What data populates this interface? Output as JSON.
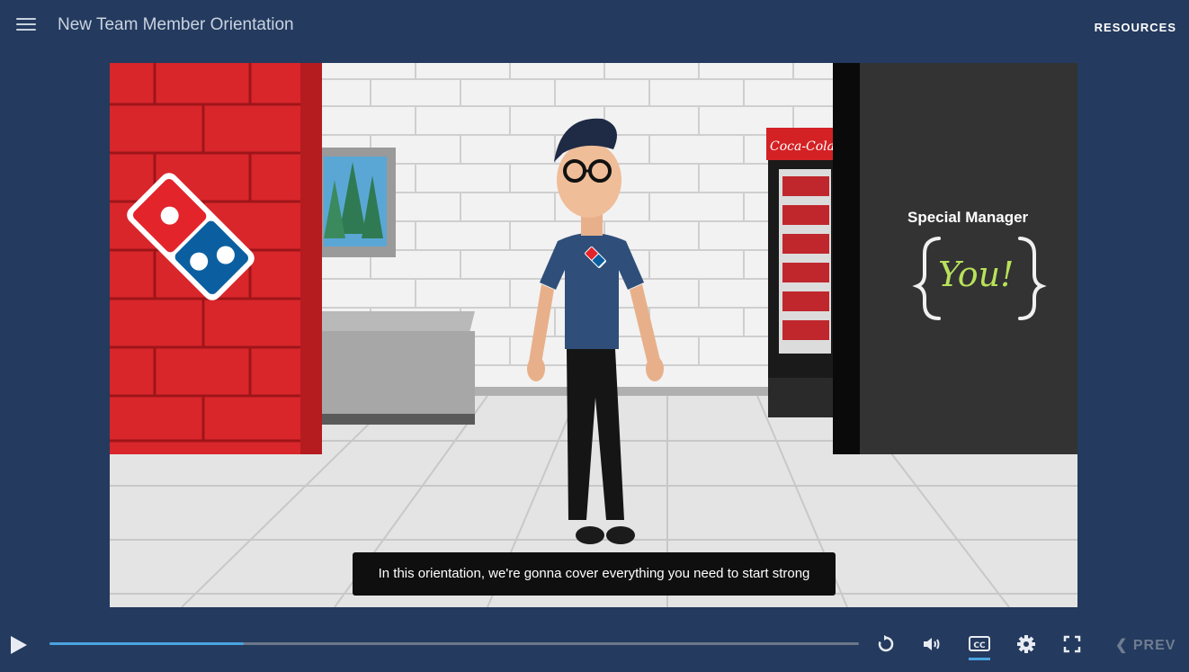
{
  "header": {
    "title": "New Team Member Orientation",
    "resources_label": "RESOURCES"
  },
  "video": {
    "caption": "In this orientation, we're gonna cover everything you need to start strong",
    "sign_title": "Special Manager",
    "sign_text": "You!",
    "fridge_brand": "Coca-Cola",
    "progress_fraction": 0.24
  },
  "controls": {
    "prev_label": "PREV",
    "icons": [
      "play-icon",
      "replay-icon",
      "volume-icon",
      "closed-captions-icon",
      "settings-icon",
      "fullscreen-icon",
      "chevron-left-icon"
    ]
  },
  "colors": {
    "background": "#243a5e",
    "progress_fill": "#4aa3e0",
    "brick_red": "#d8262b",
    "dominos_blue": "#0b5fa0"
  }
}
